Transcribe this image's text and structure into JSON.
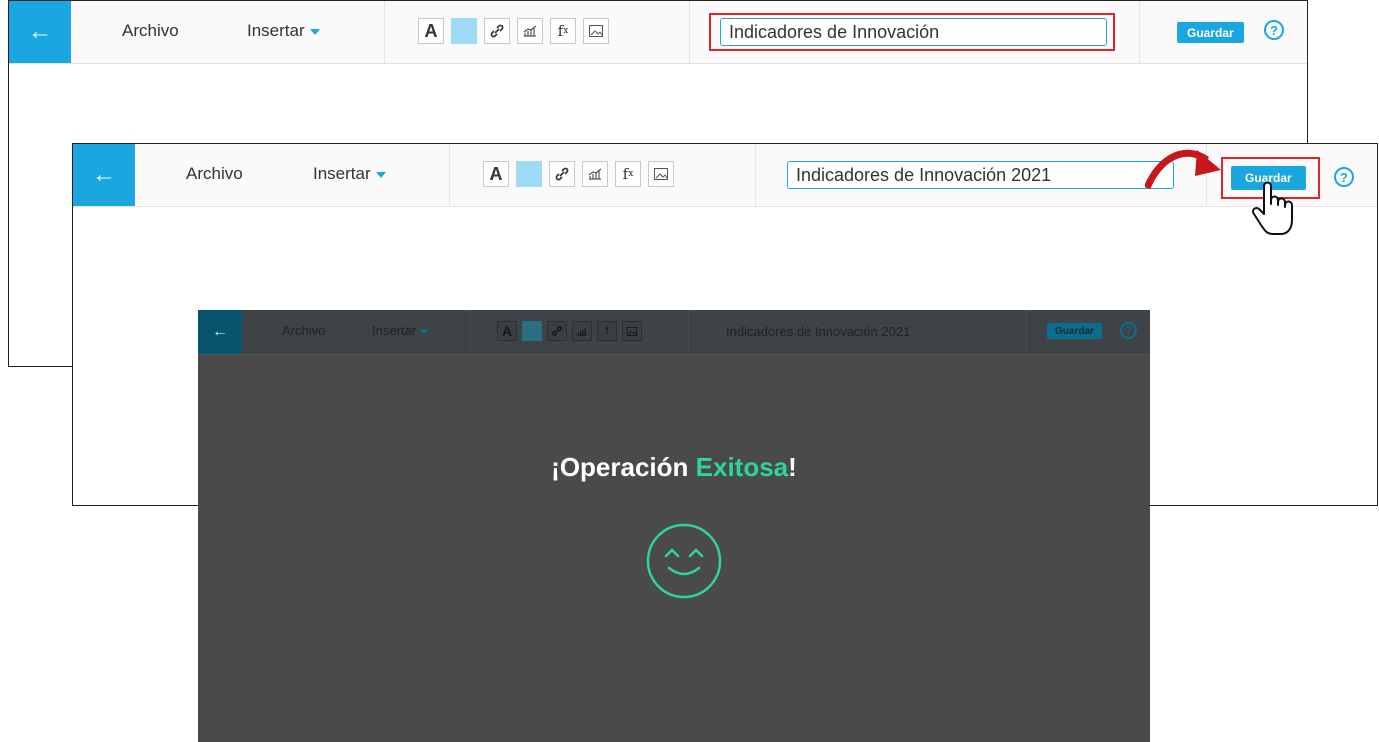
{
  "colors": {
    "accent": "#1aa7e0",
    "success": "#2ed3a0",
    "highlight": "#e5242a",
    "overlay": "#4a4a4a"
  },
  "editor": {
    "back_icon": "arrow-left-icon",
    "menu_archivo": "Archivo",
    "menu_insertar": "Insertar",
    "tools": [
      "text-format-icon",
      "fill-color-icon",
      "link-icon",
      "chart-icon",
      "formula-icon",
      "image-icon"
    ],
    "tool_text_glyph": "A",
    "tool_formula_glyph": "f",
    "tool_formula_sub": "x",
    "save_label": "Guardar",
    "help_glyph": "?"
  },
  "step1": {
    "title_value": "Indicadores de Innovación"
  },
  "step2": {
    "title_value": "Indicadores de Innovación 2021",
    "cursor_icon": "hand-pointer-icon",
    "arrow_icon": "curved-arrow-icon"
  },
  "step3": {
    "title_text": "Indicadores de Innovación 2021",
    "message_prefix": "¡Operación ",
    "message_accent": "Exitosa",
    "message_suffix": "!",
    "icon": "smiley-face-icon"
  }
}
